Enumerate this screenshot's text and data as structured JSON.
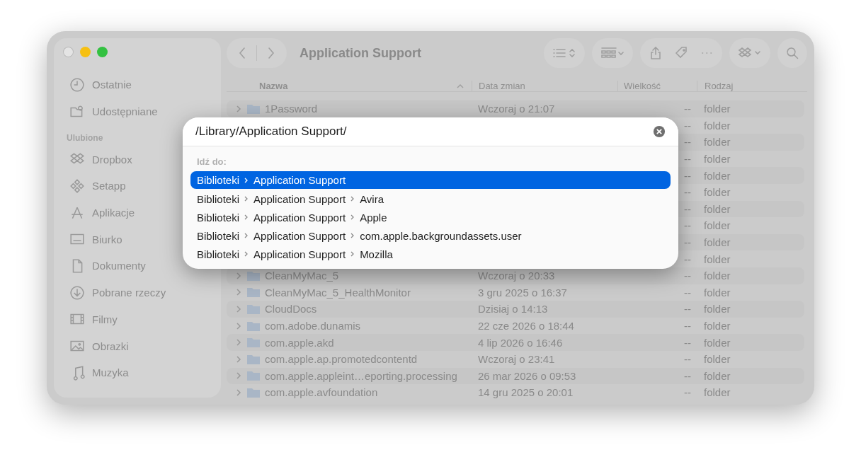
{
  "window": {
    "title": "Application Support"
  },
  "sidebar": {
    "items": [
      {
        "label": "Ostatnie"
      },
      {
        "label": "Udostępniane"
      }
    ],
    "sections": [
      {
        "title": "Ulubione",
        "items": [
          {
            "label": "Dropbox"
          },
          {
            "label": "Setapp"
          },
          {
            "label": "Aplikacje"
          },
          {
            "label": "Biurko"
          },
          {
            "label": "Dokumenty"
          },
          {
            "label": "Pobrane rzeczy"
          },
          {
            "label": "Filmy"
          },
          {
            "label": "Obrazki"
          },
          {
            "label": "Muzyka"
          }
        ]
      }
    ]
  },
  "table": {
    "columns": [
      "Nazwa",
      "Data zmian",
      "Wielkość",
      "Rodzaj"
    ],
    "rows": [
      {
        "name": "1Password",
        "date": "Wczoraj o 21:07",
        "size": "--",
        "kind": "folder"
      },
      {
        "size": "--",
        "kind": "folder"
      },
      {
        "size": "--",
        "kind": "folder"
      },
      {
        "size": "--",
        "kind": "folder"
      },
      {
        "size": "--",
        "kind": "folder"
      },
      {
        "size": "--",
        "kind": "folder"
      },
      {
        "size": "--",
        "kind": "folder"
      },
      {
        "size": "--",
        "kind": "folder"
      },
      {
        "size": "--",
        "kind": "folder"
      },
      {
        "size": "--",
        "kind": "folder"
      },
      {
        "name": "CleanMyMac_5",
        "date": "Wczoraj o 20:33",
        "size": "--",
        "kind": "folder"
      },
      {
        "name": "CleanMyMac_5_HealthMonitor",
        "date": "3 gru 2025 o 16:37",
        "size": "--",
        "kind": "folder"
      },
      {
        "name": "CloudDocs",
        "date": "Dzisiaj o 14:13",
        "size": "--",
        "kind": "folder"
      },
      {
        "name": "com.adobe.dunamis",
        "date": "22 cze 2026 o 18:44",
        "size": "--",
        "kind": "folder"
      },
      {
        "name": "com.apple.akd",
        "date": "4 lip 2026 o 16:46",
        "size": "--",
        "kind": "folder"
      },
      {
        "name": "com.apple.ap.promotedcontentd",
        "date": "Wczoraj o 23:41",
        "size": "--",
        "kind": "folder"
      },
      {
        "name": "com.apple.appleint…eporting.processing",
        "date": "26 mar 2026 o 09:53",
        "size": "--",
        "kind": "folder"
      },
      {
        "name": "com.apple.avfoundation",
        "date": "14 gru 2025 o 20:01",
        "size": "--",
        "kind": "folder"
      }
    ]
  },
  "go_to_dialog": {
    "value": "/Library/Application Support/",
    "section_title": "Idź do:",
    "suggestions": [
      {
        "path": [
          "Biblioteki",
          "Application Support"
        ],
        "selected": true
      },
      {
        "path": [
          "Biblioteki",
          "Application Support",
          "Avira"
        ],
        "selected": false
      },
      {
        "path": [
          "Biblioteki",
          "Application Support",
          "Apple"
        ],
        "selected": false
      },
      {
        "path": [
          "Biblioteki",
          "Application Support",
          "com.apple.backgroundassets.user"
        ],
        "selected": false
      },
      {
        "path": [
          "Biblioteki",
          "Application Support",
          "Mozilla"
        ],
        "selected": false
      }
    ]
  }
}
